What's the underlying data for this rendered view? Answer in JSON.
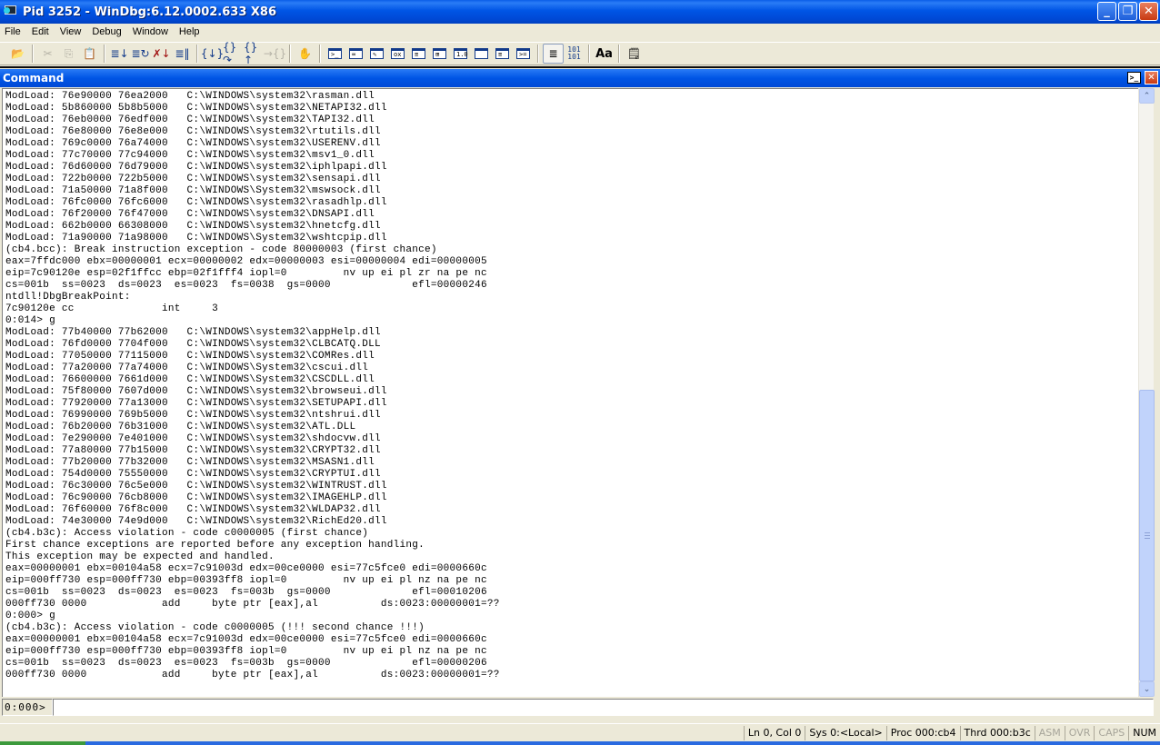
{
  "window": {
    "title": "Pid 3252 - WinDbg:6.12.0002.633 X86",
    "minimize_glyph": "_",
    "restore_glyph": "❐",
    "close_glyph": "✕"
  },
  "menu": [
    "File",
    "Edit",
    "View",
    "Debug",
    "Window",
    "Help"
  ],
  "toolbar": {
    "buttons": [
      {
        "name": "open-icon",
        "glyph": "📂",
        "enabled": true
      },
      {
        "name": "cut-icon",
        "glyph": "✂",
        "enabled": false
      },
      {
        "name": "copy-icon",
        "glyph": "⎘",
        "enabled": false
      },
      {
        "name": "paste-icon",
        "glyph": "📋",
        "enabled": true
      },
      {
        "name": "go-icon",
        "glyph": "≣↓",
        "enabled": true
      },
      {
        "name": "restart-icon",
        "glyph": "≣↻",
        "enabled": true
      },
      {
        "name": "stop-debugging-icon",
        "glyph": "✗↓",
        "enabled": true
      },
      {
        "name": "break-icon",
        "glyph": "≣‖",
        "enabled": true
      },
      {
        "name": "step-into-icon",
        "glyph": "{↓}",
        "enabled": true
      },
      {
        "name": "step-over-icon",
        "glyph": "{}↷",
        "enabled": true
      },
      {
        "name": "step-out-icon",
        "glyph": "{}↑",
        "enabled": true
      },
      {
        "name": "run-to-cursor-icon",
        "glyph": "→{}",
        "enabled": false
      },
      {
        "name": "source-mode-hand-icon",
        "glyph": "✋",
        "enabled": true
      },
      {
        "name": "command-window-icon",
        "text": ">_"
      },
      {
        "name": "watch-window-icon",
        "text": "∞"
      },
      {
        "name": "locals-window-icon",
        "text": "✎"
      },
      {
        "name": "registers-window-icon",
        "text": "ox"
      },
      {
        "name": "memory-window-icon",
        "text": "≡"
      },
      {
        "name": "call-stack-window-icon",
        "text": "⊞"
      },
      {
        "name": "disassembly-window-icon",
        "text": "1.0"
      },
      {
        "name": "scratch-pad-icon",
        "text": ""
      },
      {
        "name": "processes-threads-icon",
        "text": "≡"
      },
      {
        "name": "command-browser-icon",
        "text": ">="
      },
      {
        "name": "source-mode-toggle-icon",
        "glyph": "≣",
        "active": true
      },
      {
        "name": "hex-mode-icon",
        "text": "101\n101"
      },
      {
        "name": "font-icon",
        "text": "Aa"
      },
      {
        "name": "options-icon",
        "glyph": "🗒"
      }
    ]
  },
  "command_window": {
    "title": "Command",
    "dock_glyph": ">_",
    "close_glyph": "✕",
    "output_lines": [
      "ModLoad: 76e90000 76ea2000   C:\\WINDOWS\\system32\\rasman.dll",
      "ModLoad: 5b860000 5b8b5000   C:\\WINDOWS\\system32\\NETAPI32.dll",
      "ModLoad: 76eb0000 76edf000   C:\\WINDOWS\\system32\\TAPI32.dll",
      "ModLoad: 76e80000 76e8e000   C:\\WINDOWS\\system32\\rtutils.dll",
      "ModLoad: 769c0000 76a74000   C:\\WINDOWS\\system32\\USERENV.dll",
      "ModLoad: 77c70000 77c94000   C:\\WINDOWS\\system32\\msv1_0.dll",
      "ModLoad: 76d60000 76d79000   C:\\WINDOWS\\system32\\iphlpapi.dll",
      "ModLoad: 722b0000 722b5000   C:\\WINDOWS\\system32\\sensapi.dll",
      "ModLoad: 71a50000 71a8f000   C:\\WINDOWS\\System32\\mswsock.dll",
      "ModLoad: 76fc0000 76fc6000   C:\\WINDOWS\\system32\\rasadhlp.dll",
      "ModLoad: 76f20000 76f47000   C:\\WINDOWS\\system32\\DNSAPI.dll",
      "ModLoad: 662b0000 66308000   C:\\WINDOWS\\system32\\hnetcfg.dll",
      "ModLoad: 71a90000 71a98000   C:\\WINDOWS\\System32\\wshtcpip.dll",
      "(cb4.bcc): Break instruction exception - code 80000003 (first chance)",
      "eax=7ffdc000 ebx=00000001 ecx=00000002 edx=00000003 esi=00000004 edi=00000005",
      "eip=7c90120e esp=02f1ffcc ebp=02f1fff4 iopl=0         nv up ei pl zr na pe nc",
      "cs=001b  ss=0023  ds=0023  es=0023  fs=0038  gs=0000             efl=00000246",
      "ntdll!DbgBreakPoint:",
      "7c90120e cc              int     3",
      "0:014> g",
      "ModLoad: 77b40000 77b62000   C:\\WINDOWS\\system32\\appHelp.dll",
      "ModLoad: 76fd0000 7704f000   C:\\WINDOWS\\system32\\CLBCATQ.DLL",
      "ModLoad: 77050000 77115000   C:\\WINDOWS\\system32\\COMRes.dll",
      "ModLoad: 77a20000 77a74000   C:\\WINDOWS\\System32\\cscui.dll",
      "ModLoad: 76600000 7661d000   C:\\WINDOWS\\System32\\CSCDLL.dll",
      "ModLoad: 75f80000 7607d000   C:\\WINDOWS\\system32\\browseui.dll",
      "ModLoad: 77920000 77a13000   C:\\WINDOWS\\system32\\SETUPAPI.dll",
      "ModLoad: 76990000 769b5000   C:\\WINDOWS\\system32\\ntshrui.dll",
      "ModLoad: 76b20000 76b31000   C:\\WINDOWS\\system32\\ATL.DLL",
      "ModLoad: 7e290000 7e401000   C:\\WINDOWS\\system32\\shdocvw.dll",
      "ModLoad: 77a80000 77b15000   C:\\WINDOWS\\system32\\CRYPT32.dll",
      "ModLoad: 77b20000 77b32000   C:\\WINDOWS\\system32\\MSASN1.dll",
      "ModLoad: 754d0000 75550000   C:\\WINDOWS\\system32\\CRYPTUI.dll",
      "ModLoad: 76c30000 76c5e000   C:\\WINDOWS\\system32\\WINTRUST.dll",
      "ModLoad: 76c90000 76cb8000   C:\\WINDOWS\\system32\\IMAGEHLP.dll",
      "ModLoad: 76f60000 76f8c000   C:\\WINDOWS\\system32\\WLDAP32.dll",
      "ModLoad: 74e30000 74e9d000   C:\\WINDOWS\\system32\\RichEd20.dll",
      "(cb4.b3c): Access violation - code c0000005 (first chance)",
      "First chance exceptions are reported before any exception handling.",
      "This exception may be expected and handled.",
      "eax=00000001 ebx=00104a58 ecx=7c91003d edx=00ce0000 esi=77c5fce0 edi=0000660c",
      "eip=000ff730 esp=000ff730 ebp=00393ff8 iopl=0         nv up ei pl nz na pe nc",
      "cs=001b  ss=0023  ds=0023  es=0023  fs=003b  gs=0000             efl=00010206",
      "000ff730 0000            add     byte ptr [eax],al          ds:0023:00000001=??",
      "0:000> g",
      "(cb4.b3c): Access violation - code c0000005 (!!! second chance !!!)",
      "eax=00000001 ebx=00104a58 ecx=7c91003d edx=00ce0000 esi=77c5fce0 edi=0000660c",
      "eip=000ff730 esp=000ff730 ebp=00393ff8 iopl=0         nv up ei pl nz na pe nc",
      "cs=001b  ss=0023  ds=0023  es=0023  fs=003b  gs=0000             efl=00000206",
      "000ff730 0000            add     byte ptr [eax],al          ds:0023:00000001=??"
    ],
    "scroll": {
      "thumb_start_fraction": 0.495,
      "thumb_size_fraction": 0.505
    },
    "prompt": "0:000>",
    "input_value": "",
    "scroll_up_glyph": "⌃",
    "scroll_down_glyph": "⌄"
  },
  "statusbar": [
    {
      "name": "line-col",
      "text": "Ln 0, Col 0",
      "enabled": true
    },
    {
      "name": "system",
      "text": "Sys 0:<Local>",
      "enabled": true
    },
    {
      "name": "process",
      "text": "Proc 000:cb4",
      "enabled": true
    },
    {
      "name": "thread",
      "text": "Thrd 000:b3c",
      "enabled": true
    },
    {
      "name": "asm",
      "text": "ASM",
      "enabled": false
    },
    {
      "name": "ovr",
      "text": "OVR",
      "enabled": false
    },
    {
      "name": "caps",
      "text": "CAPS",
      "enabled": false
    },
    {
      "name": "num",
      "text": "NUM",
      "enabled": true
    }
  ]
}
